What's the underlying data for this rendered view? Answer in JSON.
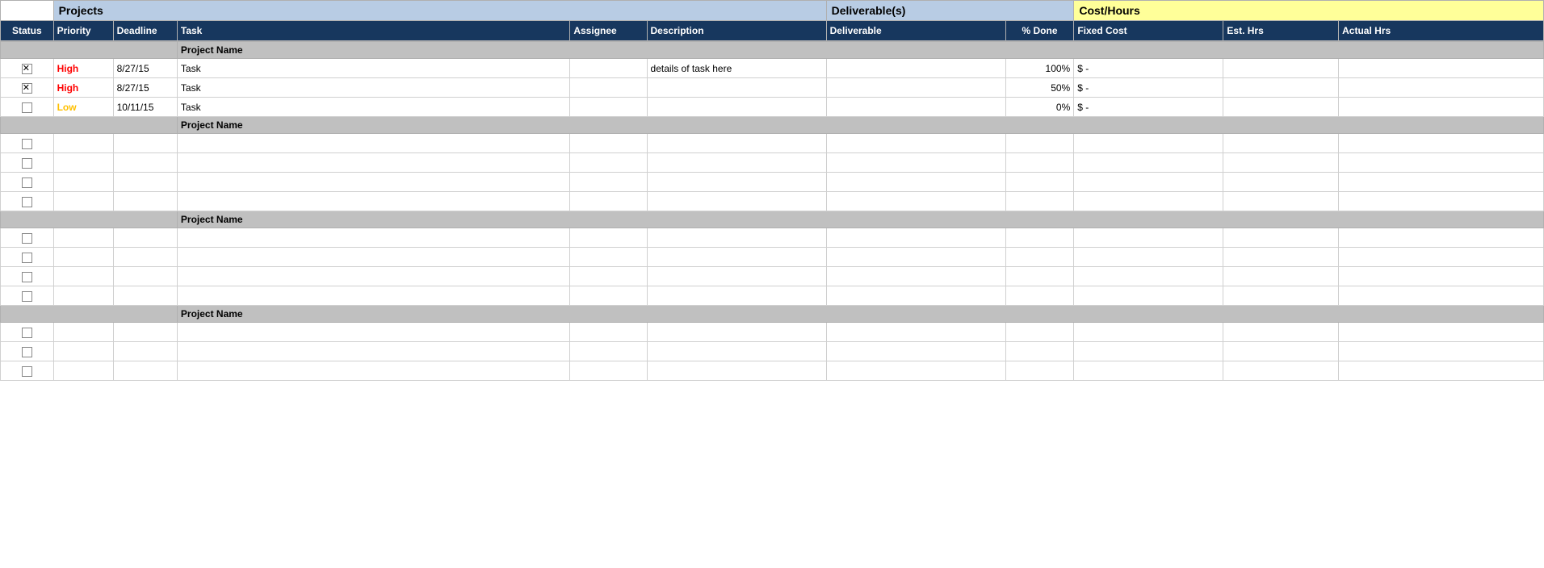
{
  "superHeaders": {
    "projects_label": "Projects",
    "deliverables_label": "Deliverable(s)",
    "costhours_label": "Cost/Hours"
  },
  "columnHeaders": {
    "status": "Status",
    "priority": "Priority",
    "deadline": "Deadline",
    "task": "Task",
    "assignee": "Assignee",
    "description": "Description",
    "deliverable": "Deliverable",
    "pct_done": "% Done",
    "fixed_cost": "Fixed Cost",
    "est_hrs": "Est. Hrs",
    "actual_hrs": "Actual Hrs"
  },
  "projects": [
    {
      "name": "Project Name",
      "rows": [
        {
          "status": "checked",
          "priority": "High",
          "priority_class": "high",
          "deadline": "8/27/15",
          "task": "Task",
          "assignee": "",
          "description": "details of task here",
          "deliverable": "",
          "pct_done": "100%",
          "fixed_cost": "$        -",
          "est_hrs": "",
          "actual_hrs": ""
        },
        {
          "status": "checked",
          "priority": "High",
          "priority_class": "high",
          "deadline": "8/27/15",
          "task": "Task",
          "assignee": "",
          "description": "",
          "deliverable": "",
          "pct_done": "50%",
          "fixed_cost": "$        -",
          "est_hrs": "",
          "actual_hrs": ""
        },
        {
          "status": "unchecked",
          "priority": "Low",
          "priority_class": "low",
          "deadline": "10/11/15",
          "task": "Task",
          "assignee": "",
          "description": "",
          "deliverable": "",
          "pct_done": "0%",
          "fixed_cost": "$        -",
          "est_hrs": "",
          "actual_hrs": ""
        }
      ]
    },
    {
      "name": "Project Name",
      "rows": [
        {
          "status": "unchecked",
          "priority": "",
          "priority_class": "",
          "deadline": "",
          "task": "",
          "assignee": "",
          "description": "",
          "deliverable": "",
          "pct_done": "",
          "fixed_cost": "",
          "est_hrs": "",
          "actual_hrs": ""
        },
        {
          "status": "unchecked",
          "priority": "",
          "priority_class": "",
          "deadline": "",
          "task": "",
          "assignee": "",
          "description": "",
          "deliverable": "",
          "pct_done": "",
          "fixed_cost": "",
          "est_hrs": "",
          "actual_hrs": ""
        },
        {
          "status": "unchecked",
          "priority": "",
          "priority_class": "",
          "deadline": "",
          "task": "",
          "assignee": "",
          "description": "",
          "deliverable": "",
          "pct_done": "",
          "fixed_cost": "",
          "est_hrs": "",
          "actual_hrs": ""
        },
        {
          "status": "unchecked",
          "priority": "",
          "priority_class": "",
          "deadline": "",
          "task": "",
          "assignee": "",
          "description": "",
          "deliverable": "",
          "pct_done": "",
          "fixed_cost": "",
          "est_hrs": "",
          "actual_hrs": ""
        }
      ]
    },
    {
      "name": "Project Name",
      "rows": [
        {
          "status": "unchecked",
          "priority": "",
          "priority_class": "",
          "deadline": "",
          "task": "",
          "assignee": "",
          "description": "",
          "deliverable": "",
          "pct_done": "",
          "fixed_cost": "",
          "est_hrs": "",
          "actual_hrs": ""
        },
        {
          "status": "unchecked",
          "priority": "",
          "priority_class": "",
          "deadline": "",
          "task": "",
          "assignee": "",
          "description": "",
          "deliverable": "",
          "pct_done": "",
          "fixed_cost": "",
          "est_hrs": "",
          "actual_hrs": ""
        },
        {
          "status": "unchecked",
          "priority": "",
          "priority_class": "",
          "deadline": "",
          "task": "",
          "assignee": "",
          "description": "",
          "deliverable": "",
          "pct_done": "",
          "fixed_cost": "",
          "est_hrs": "",
          "actual_hrs": ""
        },
        {
          "status": "unchecked",
          "priority": "",
          "priority_class": "",
          "deadline": "",
          "task": "",
          "assignee": "",
          "description": "",
          "deliverable": "",
          "pct_done": "",
          "fixed_cost": "",
          "est_hrs": "",
          "actual_hrs": ""
        }
      ]
    },
    {
      "name": "Project Name",
      "rows": [
        {
          "status": "unchecked",
          "priority": "",
          "priority_class": "",
          "deadline": "",
          "task": "",
          "assignee": "",
          "description": "",
          "deliverable": "",
          "pct_done": "",
          "fixed_cost": "",
          "est_hrs": "",
          "actual_hrs": ""
        },
        {
          "status": "unchecked",
          "priority": "",
          "priority_class": "",
          "deadline": "",
          "task": "",
          "assignee": "",
          "description": "",
          "deliverable": "",
          "pct_done": "",
          "fixed_cost": "",
          "est_hrs": "",
          "actual_hrs": ""
        },
        {
          "status": "unchecked",
          "priority": "",
          "priority_class": "",
          "deadline": "",
          "task": "",
          "assignee": "",
          "description": "",
          "deliverable": "",
          "pct_done": "",
          "fixed_cost": "",
          "est_hrs": "",
          "actual_hrs": ""
        }
      ]
    }
  ]
}
